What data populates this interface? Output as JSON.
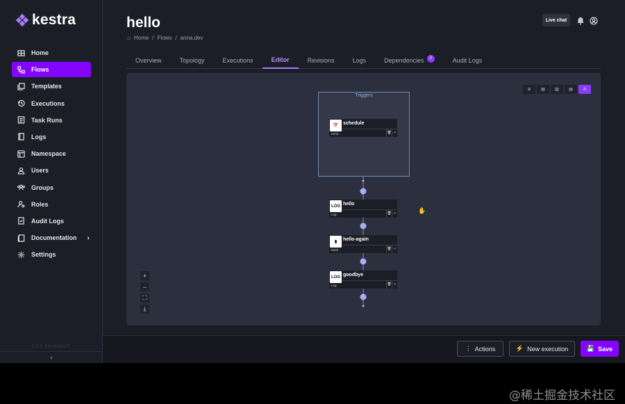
{
  "app": {
    "brand": "kestra",
    "version": "0.0.0-SNAPSHOT"
  },
  "colors": {
    "accent": "#8405ff",
    "background": "#1c1e27",
    "canvas": "#2c2f3d",
    "trigger_border": "#6a8fb8"
  },
  "sidebar": {
    "items": [
      {
        "label": "Home",
        "icon": "grid-icon"
      },
      {
        "label": "Flows",
        "icon": "flow-icon"
      },
      {
        "label": "Templates",
        "icon": "templates-icon"
      },
      {
        "label": "Executions",
        "icon": "history-icon"
      },
      {
        "label": "Task Runs",
        "icon": "list-icon"
      },
      {
        "label": "Logs",
        "icon": "notebook-icon"
      },
      {
        "label": "Namespace",
        "icon": "namespace-icon"
      },
      {
        "label": "Users",
        "icon": "user-icon"
      },
      {
        "label": "Groups",
        "icon": "group-icon"
      },
      {
        "label": "Roles",
        "icon": "roles-icon"
      },
      {
        "label": "Audit Logs",
        "icon": "audit-icon"
      },
      {
        "label": "Documentation",
        "icon": "book-icon"
      },
      {
        "label": "Settings",
        "icon": "gear-icon"
      }
    ],
    "collapse_glyph": "‹"
  },
  "header": {
    "title": "hello",
    "breadcrumb": [
      "Home",
      "/",
      "Flows",
      "/",
      "anna.dev"
    ],
    "live_chat": "Live chat"
  },
  "tabs": [
    {
      "label": "Overview"
    },
    {
      "label": "Topology"
    },
    {
      "label": "Executions"
    },
    {
      "label": "Editor",
      "active": true
    },
    {
      "label": "Revisions"
    },
    {
      "label": "Logs"
    },
    {
      "label": "Dependencies",
      "badge": "0"
    },
    {
      "label": "Audit Logs"
    }
  ],
  "topology": {
    "triggers_label": "Triggers",
    "nodes": [
      {
        "name": "schedule",
        "type": "Sche...",
        "icon_text": "📅"
      },
      {
        "name": "hello",
        "type": "Log",
        "icon_text": "LOG"
      },
      {
        "name": "hello-again",
        "type": "Bash",
        "icon_text": "▮"
      },
      {
        "name": "goodbye",
        "type": "Log",
        "icon_text": "LOG"
      }
    ]
  },
  "toolbar": [
    "⊘",
    "▤",
    "▥",
    "▤",
    "A"
  ],
  "zoom": [
    "+",
    "−",
    "⛶",
    "⤓"
  ],
  "actions": {
    "more": "Actions",
    "new_execution": "New execution",
    "save": "Save"
  },
  "watermark": "@稀土掘金技术社区"
}
